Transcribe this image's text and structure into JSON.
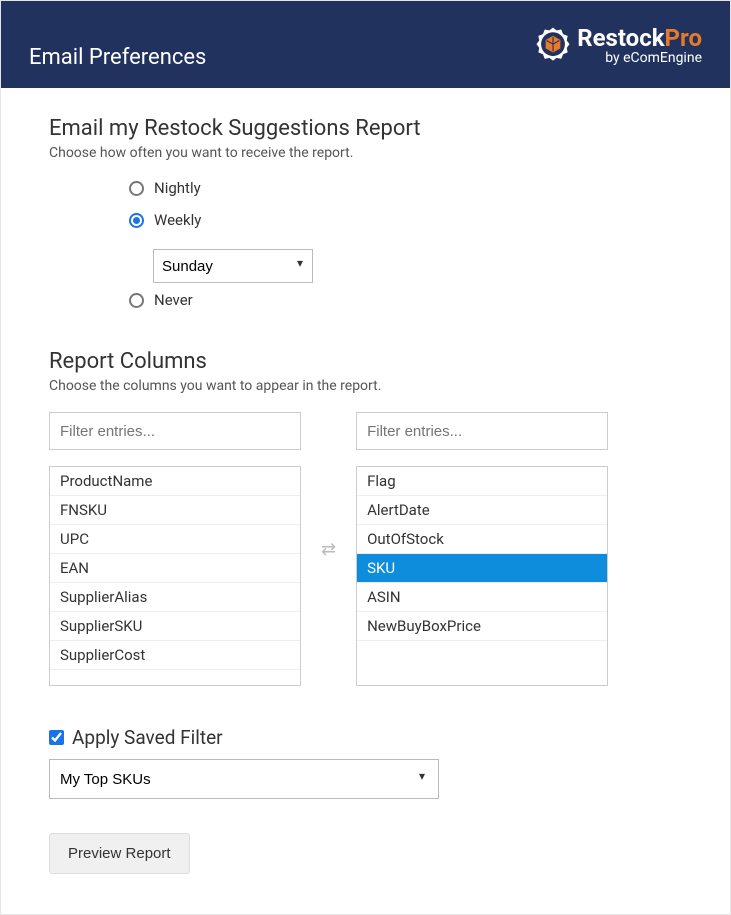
{
  "header": {
    "title": "Email Preferences",
    "logo": {
      "brand": "Restock",
      "brand_suffix": "Pro",
      "byline": "by eComEngine"
    }
  },
  "restock_report": {
    "title": "Email my Restock Suggestions Report",
    "subtitle": "Choose how often you want to receive the report.",
    "options": {
      "nightly": "Nightly",
      "weekly": "Weekly",
      "never": "Never"
    },
    "selected": "weekly",
    "weekly_day": "Sunday"
  },
  "report_columns": {
    "title": "Report Columns",
    "subtitle": "Choose the columns you want to appear in the report.",
    "filter_placeholder": "Filter entries...",
    "available": [
      "ProductName",
      "FNSKU",
      "UPC",
      "EAN",
      "SupplierAlias",
      "SupplierSKU",
      "SupplierCost"
    ],
    "chosen": [
      "Flag",
      "AlertDate",
      "OutOfStock",
      "SKU",
      "ASIN",
      "NewBuyBoxPrice"
    ],
    "chosen_selected_index": 3
  },
  "saved_filter": {
    "checkbox_label": "Apply Saved Filter",
    "checked": true,
    "value": "My Top SKUs"
  },
  "actions": {
    "preview": "Preview Report"
  }
}
